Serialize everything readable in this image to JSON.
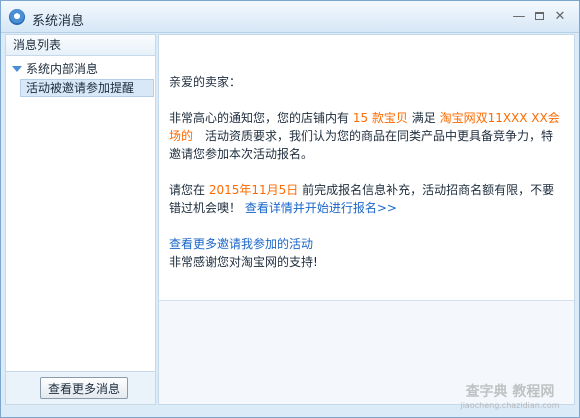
{
  "window": {
    "title": "系统消息",
    "minimize": "—",
    "close": "✕"
  },
  "sidebar": {
    "header": "消息列表",
    "group": "系统内部消息",
    "item": "活动被邀请参加提醒",
    "more_button": "查看更多消息"
  },
  "message": {
    "greeting": "亲爱的卖家：",
    "p1_a": "非常高心的通知您，您的店铺内有 ",
    "p1_hl1": "15 款宝贝",
    "p1_b": " 满足 ",
    "p1_hl2": "淘宝网双11XXX XX会场的",
    "p1_c": "　活动资质要求，我们认为您的商品在同类产品中更具备竞争力，特邀请您参加本次活动报名。",
    "p2_a": "请您在 ",
    "p2_hl": "2015年11月5日",
    "p2_b": " 前完成报名信息补充，活动招商名额有限，不要错过机会噢！ ",
    "p2_link": "查看详情并开始进行报名>>",
    "p3_link": "查看更多邀请我参加的活动",
    "p3_text": "非常感谢您对淘宝网的支持!"
  },
  "watermark": {
    "main": "查字典 教程网",
    "sub": "jiaocheng.chazidian.com"
  },
  "colors": {
    "highlight": "#ff6a00",
    "link": "#1a66c9",
    "accent": "#4a8fd6"
  }
}
